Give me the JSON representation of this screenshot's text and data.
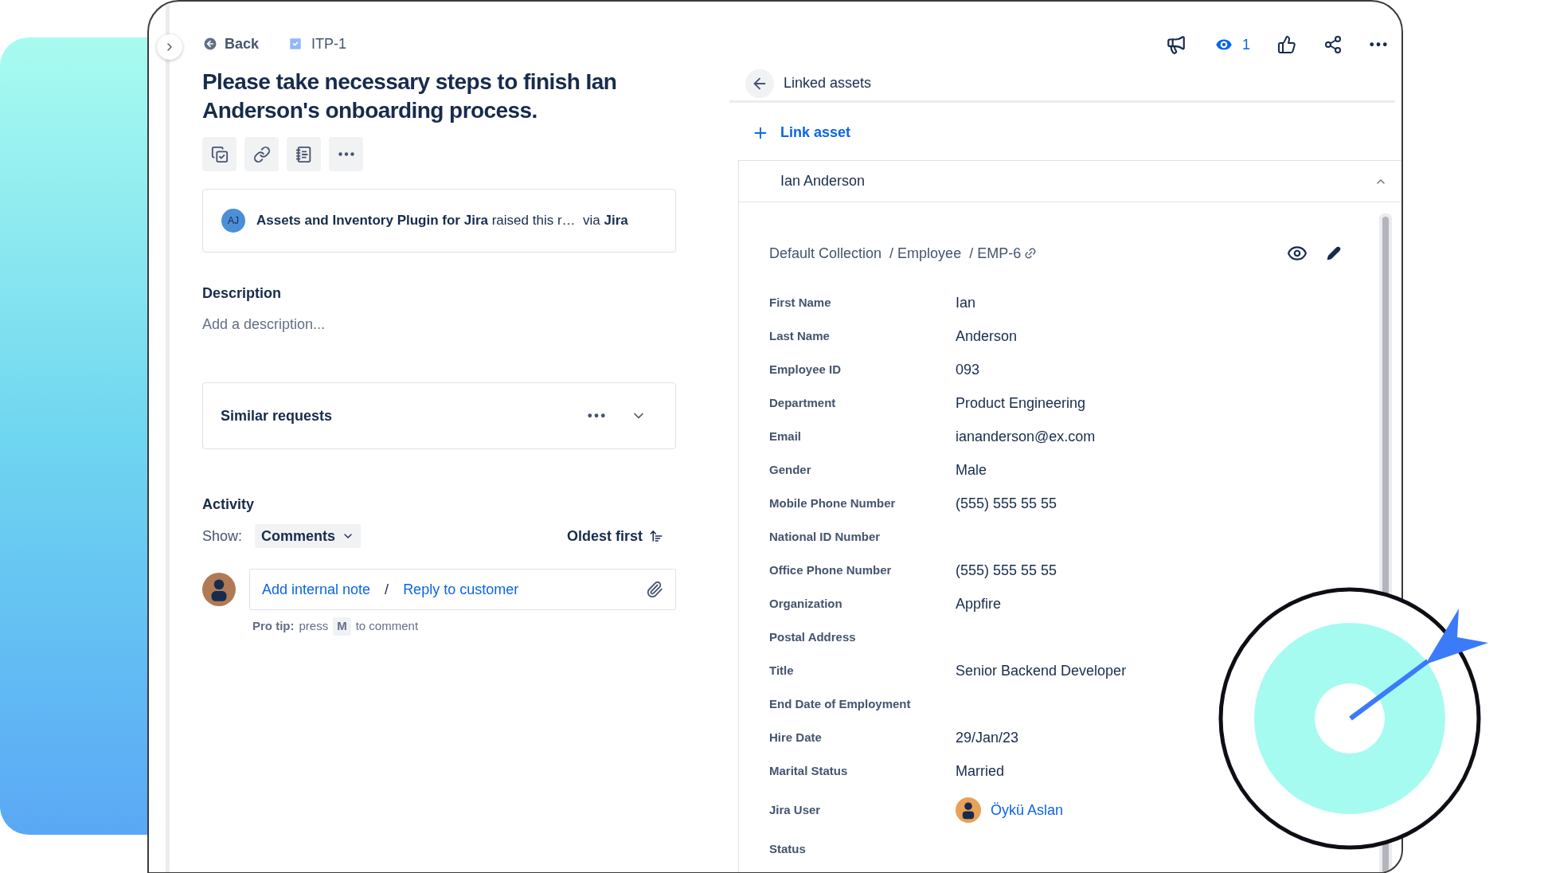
{
  "header": {
    "back": "Back",
    "issue_key": "ITP-1"
  },
  "title": "Please take necessary steps to finish Ian Anderson's onboarding process.",
  "request_source": {
    "avatar": "AJ",
    "text": "**Assets and Inventory Plugin for Jira** raised this r…  via **Jira**"
  },
  "description": {
    "heading": "Description",
    "placeholder": "Add a description..."
  },
  "similar_requests": {
    "title": "Similar requests",
    "expanded": false
  },
  "activity": {
    "heading": "Activity",
    "show_label": "Show:",
    "filter": "Comments",
    "sort": "Oldest first",
    "actions": [
      "Add internal note",
      "Reply to customer"
    ],
    "separator": "/",
    "pro_tip": {
      "label": "Pro tip:",
      "before": "press",
      "key": "M",
      "after": "to comment"
    }
  },
  "top_actions": {
    "watchers": "1"
  },
  "linked_assets": {
    "title": "Linked assets",
    "link_button": "Link asset",
    "asset": {
      "name": "Ian Anderson",
      "expanded": true,
      "breadcrumb": [
        "Default Collection",
        "Employee",
        "EMP-6"
      ],
      "separator": "/",
      "attributes": [
        {
          "label": "First Name",
          "value": "Ian",
          "kind": "text"
        },
        {
          "label": "Last Name",
          "value": "Anderson",
          "kind": "text"
        },
        {
          "label": "Employee ID",
          "value": "093",
          "kind": "text"
        },
        {
          "label": "Department",
          "value": "Product Engineering",
          "kind": "text"
        },
        {
          "label": "Email",
          "value": "iananderson@ex.com",
          "kind": "text"
        },
        {
          "label": "Gender",
          "value": "Male",
          "kind": "text"
        },
        {
          "label": "Mobile Phone Number",
          "value": "(555) 555 55 55",
          "kind": "text"
        },
        {
          "label": "National ID Number",
          "kind": "empty"
        },
        {
          "label": "Office Phone Number",
          "value": "(555) 555 55 55",
          "kind": "text"
        },
        {
          "label": "Organization",
          "value": "Appfire",
          "kind": "text"
        },
        {
          "label": "Postal Address",
          "kind": "empty"
        },
        {
          "label": "Title",
          "value": "Senior Backend Developer",
          "kind": "text"
        },
        {
          "label": "End Date of Employment",
          "kind": "empty"
        },
        {
          "label": "Hire Date",
          "value": "29/Jan/23",
          "kind": "text"
        },
        {
          "label": "Marital Status",
          "value": "Married",
          "kind": "text"
        },
        {
          "label": "Jira User",
          "value": "Öykü Aslan",
          "kind": "user"
        },
        {
          "label": "Status",
          "kind": "empty"
        }
      ]
    }
  }
}
